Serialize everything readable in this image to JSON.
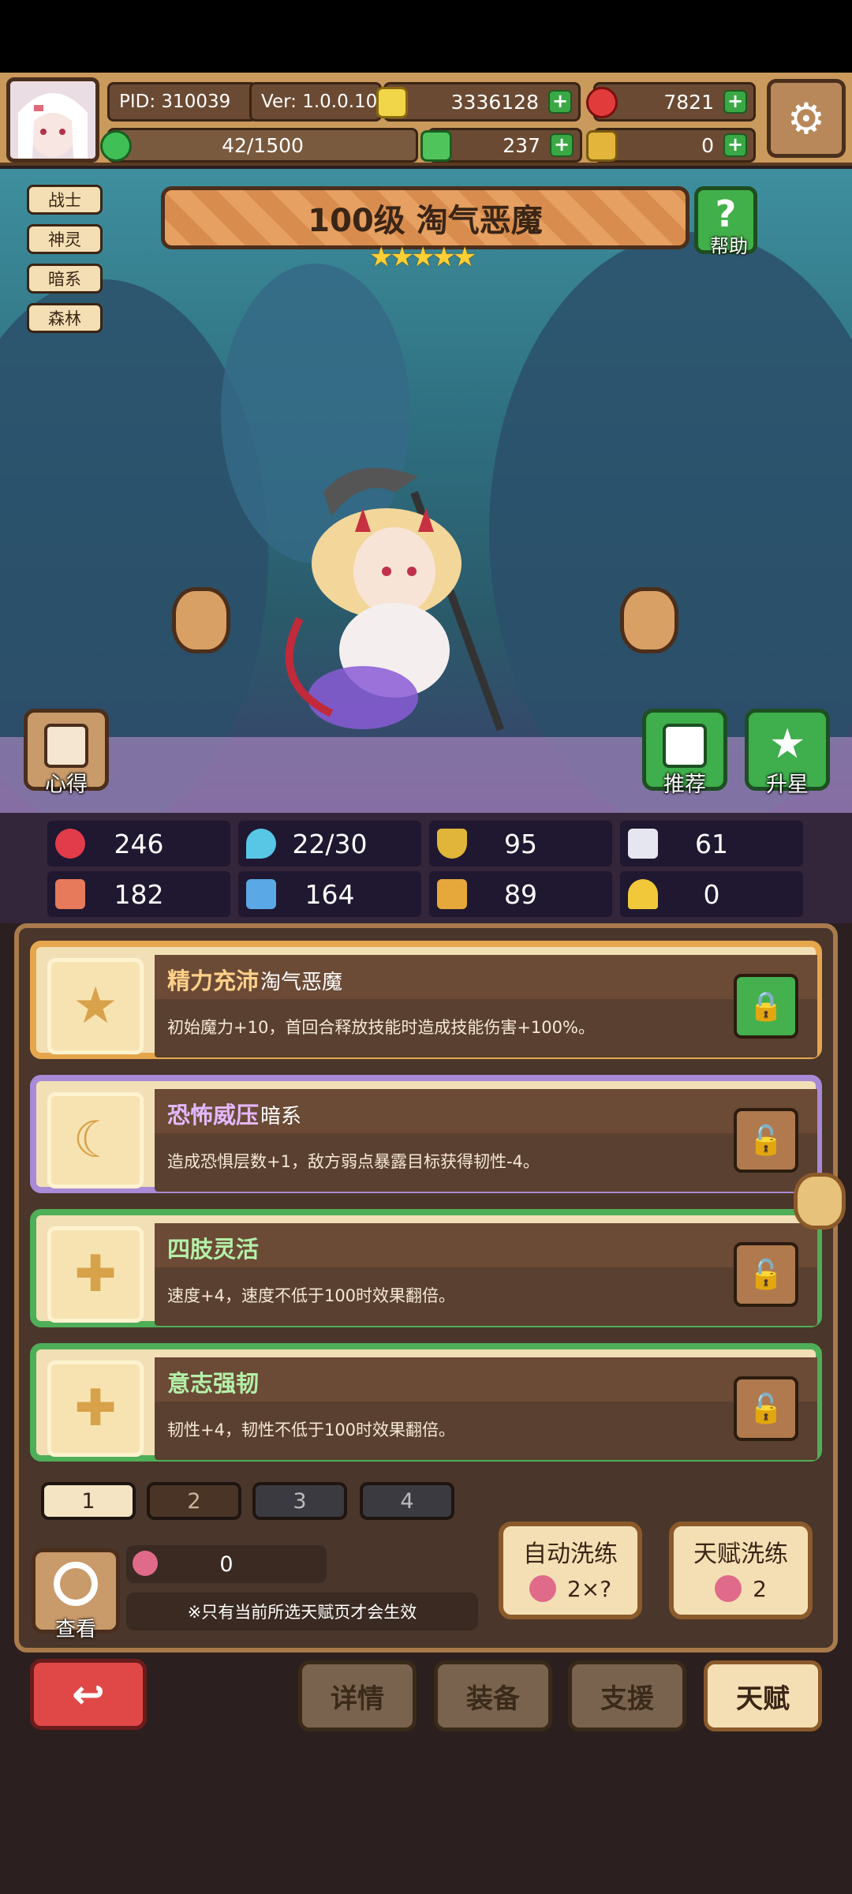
{
  "header": {
    "pid": "PID: 310039",
    "version": "Ver: 1.0.0.10",
    "gold": "3336128",
    "gems": "7821",
    "xp": "42/1500",
    "clover": "237",
    "keys": "0"
  },
  "tags": [
    "战士",
    "神灵",
    "暗系",
    "森林"
  ],
  "character": {
    "title": "100级 淘气恶魔",
    "stars": "★★★★★",
    "help_label": "帮助"
  },
  "scene_buttons": {
    "insight": "心得",
    "recommend": "推荐",
    "star_up": "升星"
  },
  "stats": [
    "246",
    "22/30",
    "95",
    "61",
    "182",
    "164",
    "89",
    "0"
  ],
  "talents": [
    {
      "name": "精力充沛",
      "sub": "淘气恶魔",
      "desc": "初始魔力+10，首回合释放技能时造成技能伤害+100%。"
    },
    {
      "name": "恐怖威压",
      "sub": "暗系",
      "desc": "造成恐惧层数+1，敌方弱点暴露目标获得韧性-4。"
    },
    {
      "name": "四肢灵活",
      "sub": "",
      "desc": "速度+4，速度不低于100时效果翻倍。"
    },
    {
      "name": "意志强韧",
      "sub": "",
      "desc": "韧性+4，韧性不低于100时效果翻倍。"
    }
  ],
  "pages": [
    "1",
    "2",
    "3",
    "4"
  ],
  "bottom_panel": {
    "view_label": "查看",
    "fruit_count": "0",
    "note": "※只有当前所选天赋页才会生效",
    "auto_refine": "自动洗练",
    "auto_cost": "2×?",
    "talent_refine": "天赋洗练",
    "talent_cost": "2"
  },
  "nav": {
    "details": "详情",
    "equipment": "装备",
    "support": "支援",
    "talent": "天赋"
  }
}
